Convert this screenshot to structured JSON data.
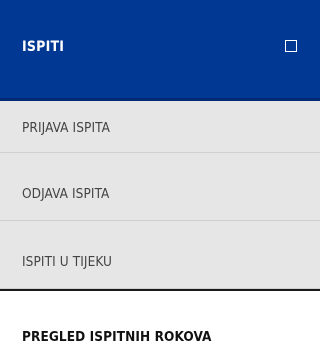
{
  "menu": {
    "header": {
      "label": "ISPITI",
      "toggle_icon": "square-icon"
    },
    "items": [
      {
        "label": "PRIJAVA ISPITA"
      },
      {
        "label": "ODJAVA ISPITA"
      },
      {
        "label": "ISPITI U TIJEKU"
      },
      {
        "label": "PREGLED ISPITNIH ROKOVA"
      }
    ]
  },
  "colors": {
    "header_background": "#003893",
    "item_background": "#e6e6e6",
    "active_item_background": "#ffffff",
    "item_text": "#444444",
    "active_item_text": "#111111"
  }
}
